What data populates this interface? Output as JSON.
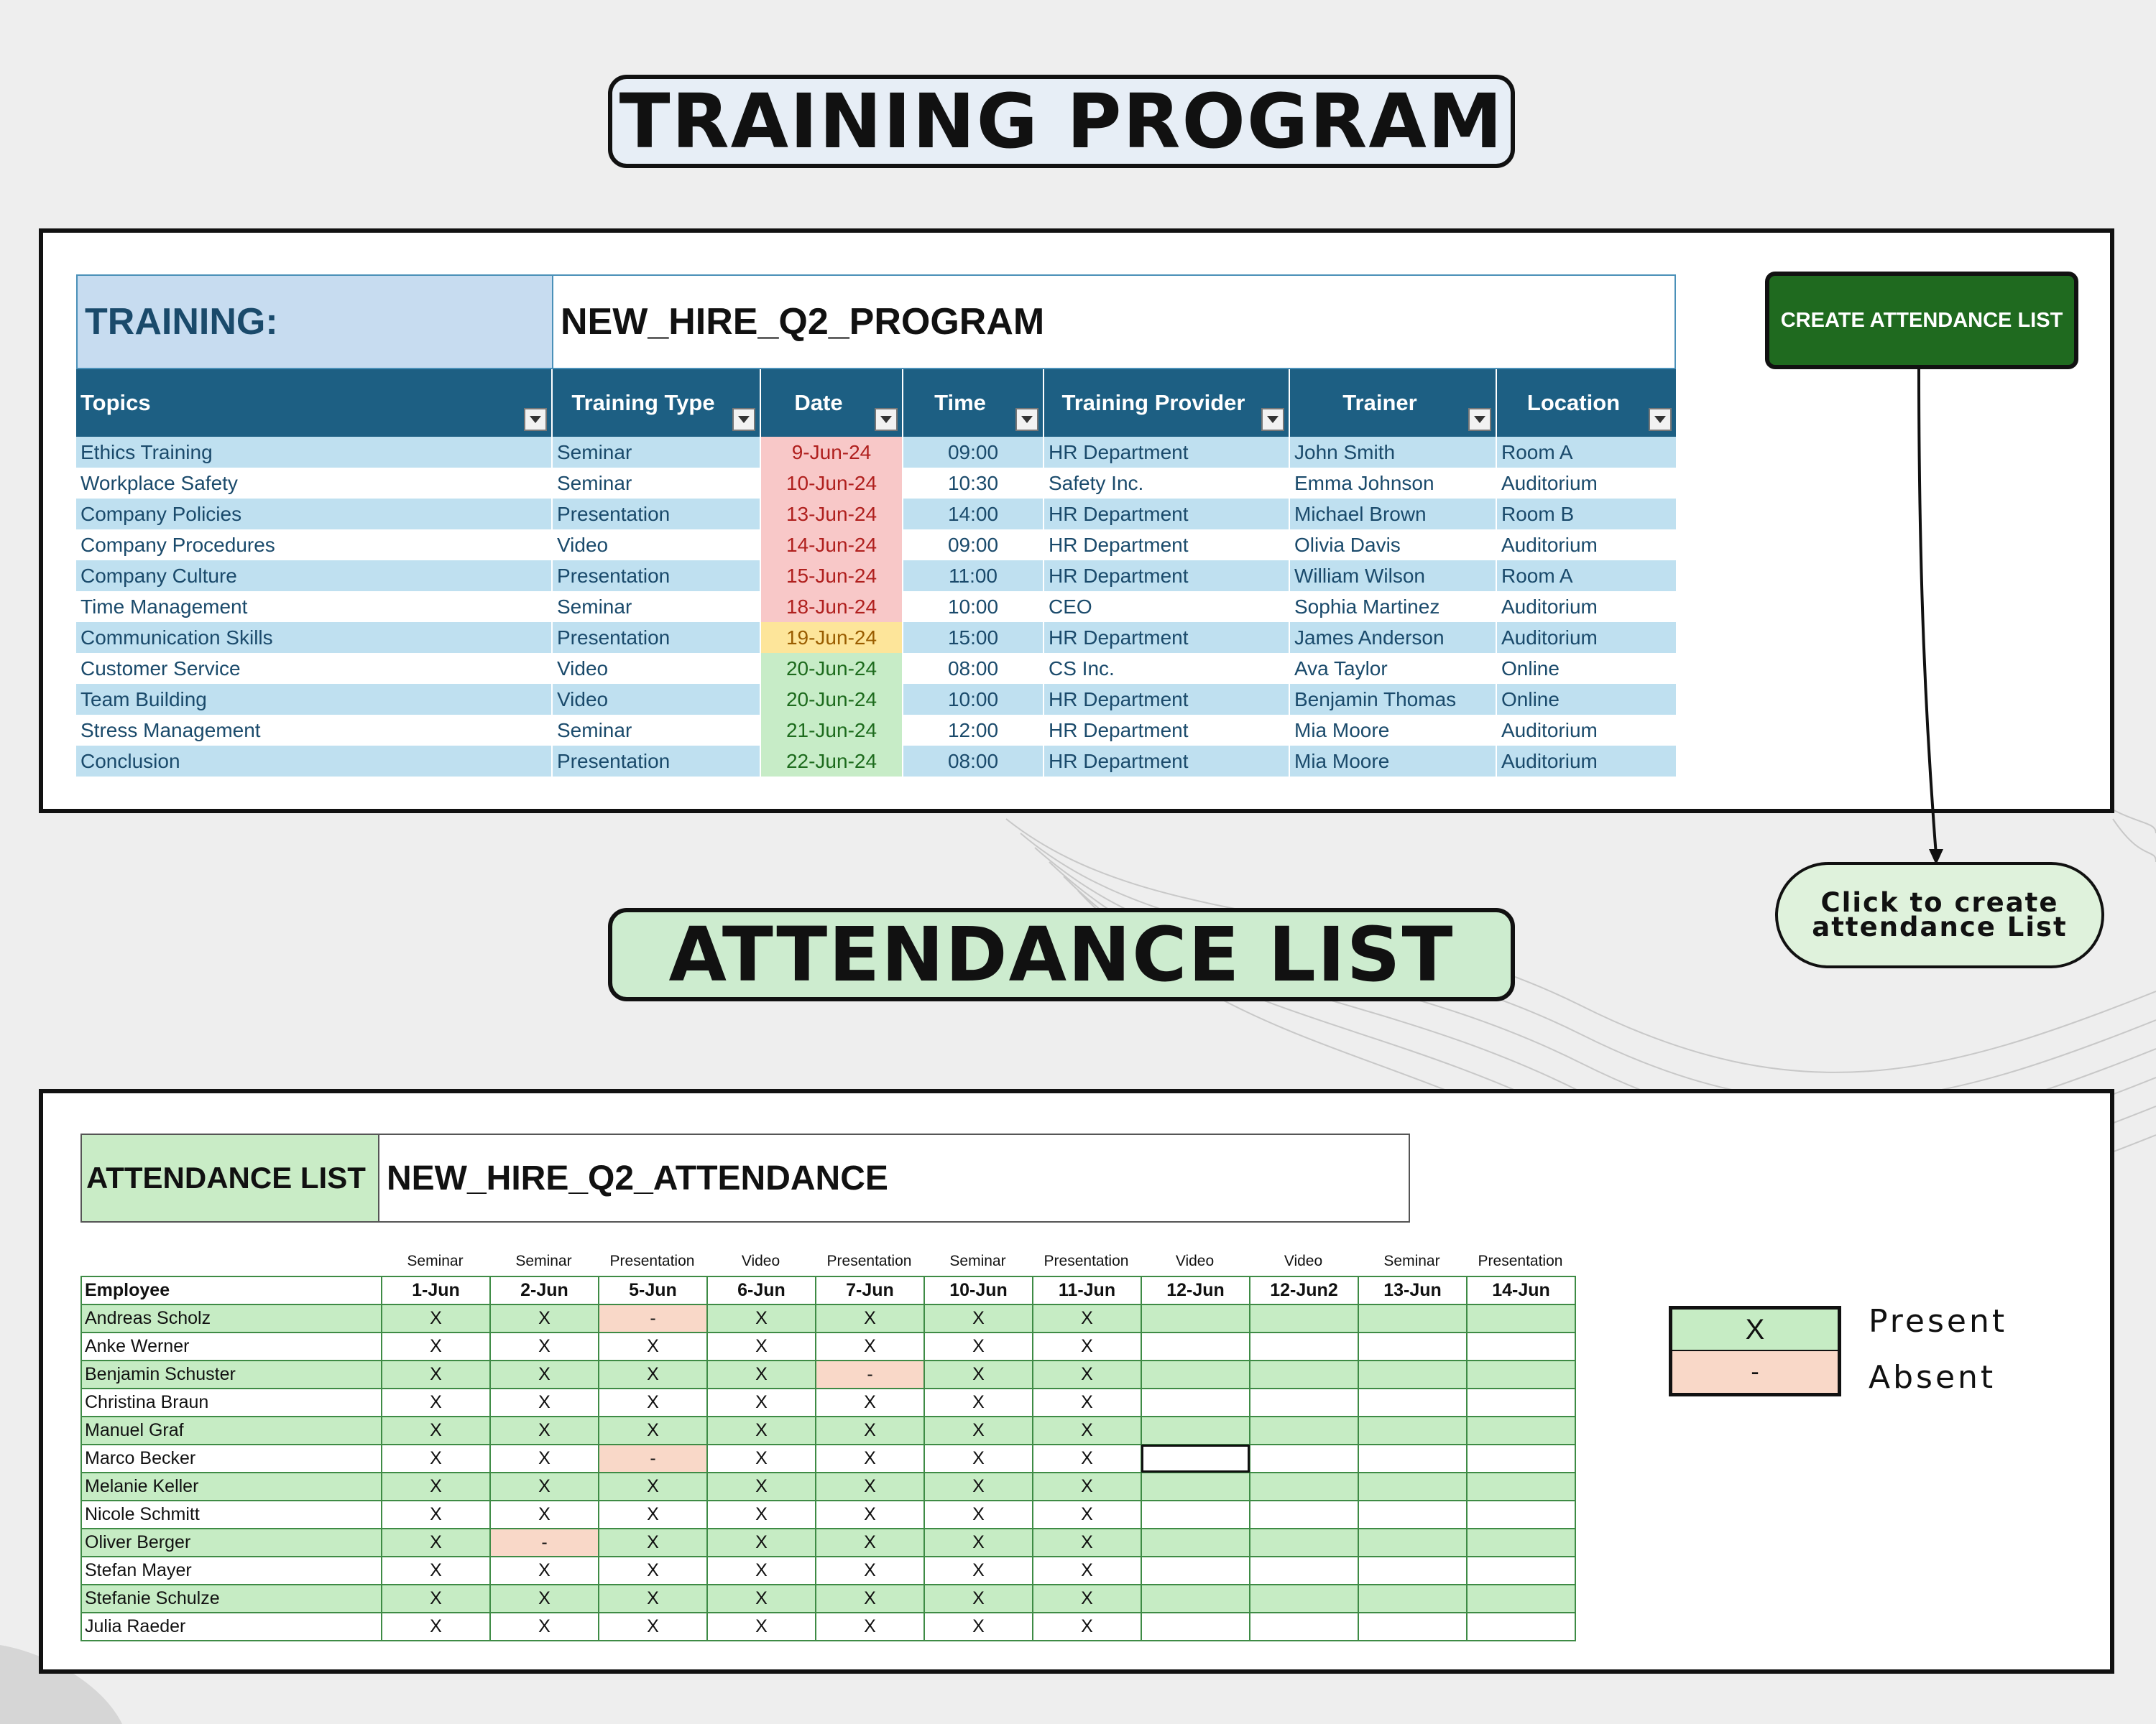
{
  "training_program": {
    "title": "TRAINING PROGRAM",
    "training_label": "TRAINING:",
    "training_name": "NEW_HIRE_Q2_PROGRAM",
    "columns": [
      "Topics",
      "Training Type",
      "Date",
      "Time",
      "Training Provider",
      "Trainer",
      "Location"
    ],
    "rows": [
      {
        "topic": "Ethics Training",
        "type": "Seminar",
        "date": "9-Jun-24",
        "date_status": "red",
        "time": "09:00",
        "provider": "HR Department",
        "trainer": "John Smith",
        "location": "Room A"
      },
      {
        "topic": "Workplace Safety",
        "type": "Seminar",
        "date": "10-Jun-24",
        "date_status": "red",
        "time": "10:30",
        "provider": "Safety Inc.",
        "trainer": "Emma Johnson",
        "location": "Auditorium"
      },
      {
        "topic": "Company Policies",
        "type": "Presentation",
        "date": "13-Jun-24",
        "date_status": "red",
        "time": "14:00",
        "provider": "HR Department",
        "trainer": "Michael Brown",
        "location": "Room B"
      },
      {
        "topic": "Company Procedures",
        "type": "Video",
        "date": "14-Jun-24",
        "date_status": "red",
        "time": "09:00",
        "provider": "HR Department",
        "trainer": "Olivia Davis",
        "location": "Auditorium"
      },
      {
        "topic": "Company Culture",
        "type": "Presentation",
        "date": "15-Jun-24",
        "date_status": "red",
        "time": "11:00",
        "provider": "HR Department",
        "trainer": "William Wilson",
        "location": "Room A"
      },
      {
        "topic": "Time Management",
        "type": "Seminar",
        "date": "18-Jun-24",
        "date_status": "red",
        "time": "10:00",
        "provider": "CEO",
        "trainer": "Sophia Martinez",
        "location": "Auditorium"
      },
      {
        "topic": "Communication Skills",
        "type": "Presentation",
        "date": "19-Jun-24",
        "date_status": "yellow",
        "time": "15:00",
        "provider": "HR Department",
        "trainer": "James Anderson",
        "location": "Auditorium"
      },
      {
        "topic": "Customer Service",
        "type": "Video",
        "date": "20-Jun-24",
        "date_status": "green",
        "time": "08:00",
        "provider": "CS Inc.",
        "trainer": "Ava Taylor",
        "location": "Online"
      },
      {
        "topic": "Team Building",
        "type": "Video",
        "date": "20-Jun-24",
        "date_status": "green",
        "time": "10:00",
        "provider": "HR Department",
        "trainer": "Benjamin Thomas",
        "location": "Online"
      },
      {
        "topic": "Stress Management",
        "type": "Seminar",
        "date": "21-Jun-24",
        "date_status": "green",
        "time": "12:00",
        "provider": "HR Department",
        "trainer": "Mia Moore",
        "location": "Auditorium"
      },
      {
        "topic": "Conclusion",
        "type": "Presentation",
        "date": "22-Jun-24",
        "date_status": "green",
        "time": "08:00",
        "provider": "HR Department",
        "trainer": "Mia Moore",
        "location": "Auditorium"
      }
    ]
  },
  "create_button": {
    "label": "CREATE ATTENDANCE LIST"
  },
  "callout": {
    "line1": "Click to create",
    "line2": "attendance List"
  },
  "attendance": {
    "title": "ATTENDANCE LIST",
    "label": "ATTENDANCE LIST",
    "name": "NEW_HIRE_Q2_ATTENDANCE",
    "employee_header": "Employee",
    "session_types": [
      "Seminar",
      "Seminar",
      "Presentation",
      "Video",
      "Presentation",
      "Seminar",
      "Presentation",
      "Video",
      "Video",
      "Seminar",
      "Presentation"
    ],
    "session_dates": [
      "1-Jun",
      "2-Jun",
      "5-Jun",
      "6-Jun",
      "7-Jun",
      "10-Jun",
      "11-Jun",
      "12-Jun",
      "12-Jun2",
      "13-Jun",
      "14-Jun"
    ],
    "rows": [
      {
        "name": "Andreas Scholz",
        "marks": [
          "X",
          "X",
          "-",
          "X",
          "X",
          "X",
          "X",
          "",
          "",
          "",
          ""
        ]
      },
      {
        "name": "Anke Werner",
        "marks": [
          "X",
          "X",
          "X",
          "X",
          "X",
          "X",
          "X",
          "",
          "",
          "",
          ""
        ]
      },
      {
        "name": "Benjamin Schuster",
        "marks": [
          "X",
          "X",
          "X",
          "X",
          "-",
          "X",
          "X",
          "",
          "",
          "",
          ""
        ]
      },
      {
        "name": "Christina Braun",
        "marks": [
          "X",
          "X",
          "X",
          "X",
          "X",
          "X",
          "X",
          "",
          "",
          "",
          ""
        ]
      },
      {
        "name": "Manuel Graf",
        "marks": [
          "X",
          "X",
          "X",
          "X",
          "X",
          "X",
          "X",
          "",
          "",
          "",
          ""
        ]
      },
      {
        "name": "Marco Becker",
        "marks": [
          "X",
          "X",
          "-",
          "X",
          "X",
          "X",
          "X",
          "",
          "",
          "",
          ""
        ]
      },
      {
        "name": "Melanie Keller",
        "marks": [
          "X",
          "X",
          "X",
          "X",
          "X",
          "X",
          "X",
          "",
          "",
          "",
          ""
        ]
      },
      {
        "name": "Nicole Schmitt",
        "marks": [
          "X",
          "X",
          "X",
          "X",
          "X",
          "X",
          "X",
          "",
          "",
          "",
          ""
        ]
      },
      {
        "name": "Oliver Berger",
        "marks": [
          "X",
          "-",
          "X",
          "X",
          "X",
          "X",
          "X",
          "",
          "",
          "",
          ""
        ]
      },
      {
        "name": "Stefan Mayer",
        "marks": [
          "X",
          "X",
          "X",
          "X",
          "X",
          "X",
          "X",
          "",
          "",
          "",
          ""
        ]
      },
      {
        "name": "Stefanie Schulze",
        "marks": [
          "X",
          "X",
          "X",
          "X",
          "X",
          "X",
          "X",
          "",
          "",
          "",
          ""
        ]
      },
      {
        "name": "Julia Raeder",
        "marks": [
          "X",
          "X",
          "X",
          "X",
          "X",
          "X",
          "X",
          "",
          "",
          "",
          ""
        ]
      }
    ]
  },
  "legend": {
    "present_symbol": "X",
    "present_label": "Present",
    "absent_symbol": "-",
    "absent_label": "Absent"
  },
  "colors": {
    "header_blue": "#1d5f83",
    "row_blue": "#bfe0f0",
    "date_red": "#f8c8c8",
    "date_yellow": "#fde59a",
    "date_green": "#c7ecc7",
    "attend_green": "#c6ecc4",
    "absent_peach": "#f9d8c8",
    "button_green": "#1f6a1f"
  }
}
